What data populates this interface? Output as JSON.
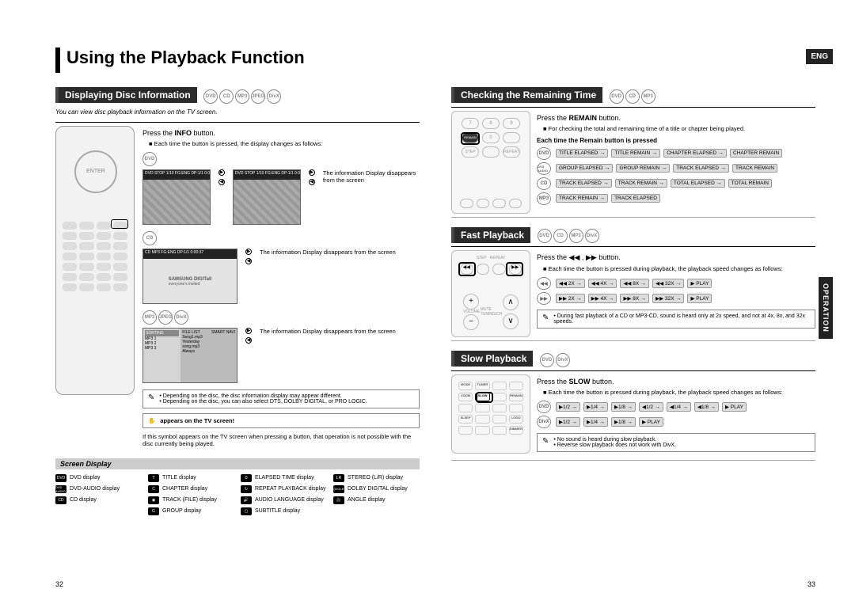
{
  "page_title": "Using the Playback Function",
  "lang_tab": "ENG",
  "side_tab": "OPERATION",
  "page_num_left": "32",
  "page_num_right": "33",
  "left": {
    "section1_title": "Displaying Disc Information",
    "badges1": [
      "DVD",
      "CD",
      "MP3",
      "JPEG",
      "DivX"
    ],
    "intro": "You can view disc playback information  on the TV screen.",
    "instr": "Press the INFO button.",
    "bullet": "Each time the button is pressed, the display changes as follows:",
    "groups": [
      {
        "badge": "DVD",
        "thumb_bar": "DVD  STOP  1/10  FG:ENG  DP:1/1  0:00:37",
        "caption": "The information Display disappears from the screen"
      },
      {
        "badge": "CD",
        "thumb_bar": "CD  MP3  FG:ENG  DP:1/1  0:00:37",
        "brand": "SAMSUNG DIGITall",
        "brandsub": "everyone's invited",
        "caption": "The information Display disappears from the screen"
      },
      {
        "badges": [
          "MP3",
          "JPEG",
          "DivX"
        ],
        "list": [
          "MP3 1",
          "MP3 2",
          "MP3 3"
        ],
        "filelist": [
          "Song1.mp3",
          "Yesterday",
          "song.mp3",
          "Always"
        ],
        "caption": "The information Display disappears from the screen"
      }
    ],
    "note_lines": [
      "Depending on the disc, the disc information display may appear different.",
      "Depending on the disc, you can also select DTS, DOLBY DIGITAL, or PRO LOGIC."
    ],
    "warn": {
      "icon": "✋",
      "text": "appears on the TV screen!"
    },
    "footnote": "If this symbol appears on the TV screen when pressing a button, that operation is not possible with the disc currently being played.",
    "subhead": "Screen Display",
    "legend_items": [
      {
        "ic": "DVD",
        "lbl": "DVD display"
      },
      {
        "ic": "T",
        "lbl": "TITLE display"
      },
      {
        "ic": "⏱",
        "lbl": "ELAPSED TIME display"
      },
      {
        "ic": "LR",
        "lbl": "STEREO (L/R) display"
      },
      {
        "ic": "DVD AUDIO",
        "lbl": "DVD-AUDIO display"
      },
      {
        "ic": "C",
        "lbl": "CHAPTER display"
      },
      {
        "ic": "↻",
        "lbl": "REPEAT PLAYBACK display"
      },
      {
        "ic": "▯▯DOLBY",
        "lbl": "DOLBY DIGITAL display"
      },
      {
        "ic": "CD",
        "lbl": "CD display"
      },
      {
        "ic": "◉",
        "lbl": "TRACK (FILE) display"
      },
      {
        "ic": "🔊",
        "lbl": "AUDIO LANGUAGE display"
      },
      {
        "ic": "🎥",
        "lbl": "ANGLE display"
      },
      {
        "ic": "",
        "lbl": ""
      },
      {
        "ic": "G",
        "lbl": "GROUP display"
      },
      {
        "ic": "▢",
        "lbl": "SUBTITLE display"
      },
      {
        "ic": "",
        "lbl": ""
      }
    ]
  },
  "right": {
    "sec1": {
      "title": "Checking the Remaining Time",
      "badges": [
        "DVD",
        "CD",
        "MP3"
      ],
      "instr": "Press the REMAIN button.",
      "bullet": "For checking the total and remaining time of a title or chapter being played.",
      "sub": "Each time the Remain button is pressed",
      "seq": [
        {
          "lead": "DVD",
          "pills": [
            "TITLE ELAPSED",
            "TITLE REMAIN",
            "CHAPTER ELAPSED",
            "CHAPTER REMAIN"
          ]
        },
        {
          "lead": "DVD AUDIO",
          "pills": [
            "GROUP ELAPSED",
            "GROUP REMAIN",
            "TRACK ELAPSED",
            "TRACK REMAIN"
          ]
        },
        {
          "lead": "CD",
          "pills": [
            "TRACK ELAPSED",
            "TRACK REMAIN",
            "TOTAL ELAPSED",
            "TOTAL REMAIN"
          ]
        },
        {
          "lead": "MP3",
          "pills": [
            "TRACK REMAIN",
            "TRACK ELAPSED"
          ]
        }
      ]
    },
    "sec2": {
      "title": "Fast Playback",
      "badges": [
        "DVD",
        "CD",
        "MP3",
        "DivX"
      ],
      "instr": "Press the ◀◀ , ▶▶ button.",
      "bullet": "Each time the button is pressed during playback, the playback speed changes as follows:",
      "seq": [
        {
          "lead": "◀◀",
          "pills": [
            "◀◀ 2X",
            "◀◀ 4X",
            "◀◀ 8X",
            "◀◀ 32X",
            "▶ PLAY"
          ]
        },
        {
          "lead": "▶▶",
          "pills": [
            "▶▶ 2X",
            "▶▶ 4X",
            "▶▶ 8X",
            "▶▶ 32X",
            "▶ PLAY"
          ]
        }
      ],
      "note": "During fast playback of a CD or MP3-CD, sound is heard only at 2x speed, and not at 4x, 8x, and 32x speeds."
    },
    "sec3": {
      "title": "Slow Playback",
      "badges": [
        "DVD",
        "DivX"
      ],
      "instr": "Press the SLOW button.",
      "bullet": "Each time the button is pressed during playback, the playback speed changes as follows:",
      "seq": [
        {
          "lead": "DVD",
          "pills": [
            "▶1/2",
            "▶1/4",
            "▶1/8",
            "◀1/2",
            "◀1/4",
            "◀1/8",
            "▶ PLAY"
          ]
        },
        {
          "lead": "DivX",
          "pills": [
            "▶1/2",
            "▶1/4",
            "▶1/8",
            "▶ PLAY"
          ]
        }
      ],
      "note_lines": [
        "No sound is heard during slow playback.",
        "Reverse slow playback does not work with DivX."
      ]
    }
  }
}
